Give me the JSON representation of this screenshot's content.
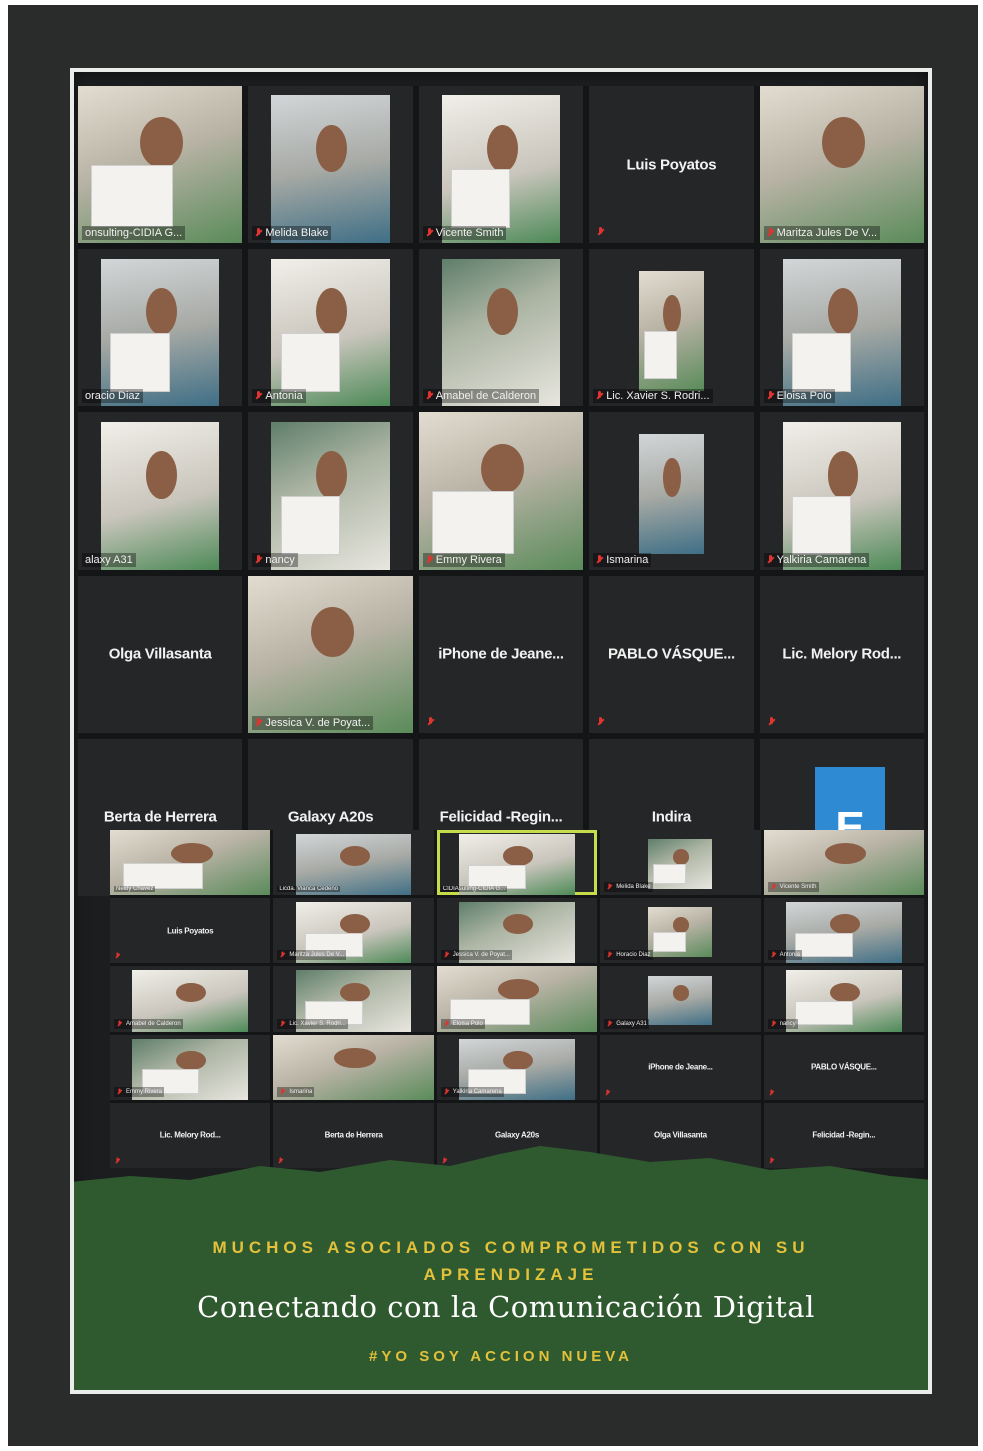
{
  "meeting_main": {
    "tiles": [
      {
        "label": "onsulting-CIDIA G...",
        "kind": "video",
        "active": true,
        "mic_muted": false
      },
      {
        "label": "Melida Blake",
        "kind": "video",
        "mic_muted": true
      },
      {
        "label": "Vicente Smith",
        "kind": "video",
        "mic_muted": true
      },
      {
        "label": "Luis Poyatos",
        "kind": "name",
        "mic_muted": true
      },
      {
        "label": "Maritza Jules De V...",
        "kind": "video",
        "mic_muted": true
      },
      {
        "label": "oracio Diaz",
        "kind": "video",
        "mic_muted": false
      },
      {
        "label": "Antonia",
        "kind": "video",
        "mic_muted": true
      },
      {
        "label": "Amabel de Calderon",
        "kind": "video",
        "mic_muted": true
      },
      {
        "label": "Lic. Xavier S. Rodri...",
        "kind": "video",
        "mic_muted": true
      },
      {
        "label": "Eloisa Polo",
        "kind": "video",
        "mic_muted": true
      },
      {
        "label": "alaxy A31",
        "kind": "video",
        "mic_muted": false
      },
      {
        "label": "nancy",
        "kind": "video",
        "mic_muted": true
      },
      {
        "label": "Emmy Rivera",
        "kind": "video",
        "mic_muted": true
      },
      {
        "label": "Ismarina",
        "kind": "video",
        "mic_muted": true
      },
      {
        "label": "Yalkiria Camarena",
        "kind": "video",
        "mic_muted": true
      },
      {
        "label": "Olga Villasanta",
        "kind": "name",
        "mic_muted": false
      },
      {
        "label": "Jessica V. de Poyat...",
        "kind": "video",
        "mic_muted": true
      },
      {
        "label": "iPhone de Jeane...",
        "kind": "name",
        "mic_muted": true
      },
      {
        "label": "PABLO VÁSQUE...",
        "kind": "name",
        "mic_muted": true
      },
      {
        "label": "Lic. Melory Rod...",
        "kind": "name",
        "mic_muted": true
      },
      {
        "label": "Berta de Herrera",
        "kind": "name",
        "mic_muted": false
      },
      {
        "label": "Galaxy A20s",
        "kind": "name",
        "mic_muted": false
      },
      {
        "label": "Felicidad -Regin...",
        "kind": "name",
        "mic_muted": false
      },
      {
        "label": "Indira",
        "kind": "name",
        "mic_muted": false
      },
      {
        "label": "E",
        "kind": "avatar",
        "mic_muted": false
      }
    ]
  },
  "meeting_secondary": {
    "tiles": [
      {
        "label": "Neidy Chávez",
        "kind": "video",
        "mic_muted": false
      },
      {
        "label": "Licda. Vianca Cedeño",
        "kind": "video",
        "mic_muted": false
      },
      {
        "label": "CIDIAsulting-CIDIA G...",
        "kind": "video",
        "active": true,
        "mic_muted": false
      },
      {
        "label": "Melida Blake",
        "kind": "video",
        "mic_muted": true
      },
      {
        "label": "Vicente Smith",
        "kind": "video",
        "mic_muted": true
      },
      {
        "label": "Luis Poyatos",
        "kind": "name",
        "mic_muted": true
      },
      {
        "label": "Maritza Jules De V...",
        "kind": "video",
        "mic_muted": true
      },
      {
        "label": "Jessica V. de Poyat...",
        "kind": "video",
        "mic_muted": true
      },
      {
        "label": "Horacio Diaz",
        "kind": "video",
        "mic_muted": true
      },
      {
        "label": "Antonia",
        "kind": "video",
        "mic_muted": true
      },
      {
        "label": "Amabel de Calderon",
        "kind": "video",
        "mic_muted": true
      },
      {
        "label": "Lic. Xavier S. Rodri...",
        "kind": "video",
        "mic_muted": true
      },
      {
        "label": "Eloisa Polo",
        "kind": "video",
        "mic_muted": true
      },
      {
        "label": "Galaxy A31",
        "kind": "video",
        "mic_muted": true
      },
      {
        "label": "nancy",
        "kind": "video",
        "mic_muted": true
      },
      {
        "label": "Emmy Rivera",
        "kind": "video",
        "mic_muted": true
      },
      {
        "label": "Ismarina",
        "kind": "video",
        "mic_muted": true
      },
      {
        "label": "Yalkiria Camarena",
        "kind": "video",
        "mic_muted": true
      },
      {
        "label": "iPhone de Jeane...",
        "kind": "name",
        "mic_muted": true
      },
      {
        "label": "PABLO VÁSQUE...",
        "kind": "name",
        "mic_muted": true
      },
      {
        "label": "Lic. Melory Rod...",
        "kind": "name",
        "mic_muted": true
      },
      {
        "label": "Berta de Herrera",
        "kind": "name",
        "mic_muted": true
      },
      {
        "label": "Galaxy A20s",
        "kind": "name",
        "mic_muted": true
      },
      {
        "label": "Olga Villasanta",
        "kind": "name",
        "mic_muted": true
      },
      {
        "label": "Felicidad -Regin...",
        "kind": "name",
        "mic_muted": true
      }
    ]
  },
  "footer": {
    "headline": "MUCHOS ASOCIADOS COMPROMETIDOS CON SU APRENDIZAJE",
    "subtitle": "Conectando con la Comunicación Digital",
    "hashtag": "#YO SOY ACCION NUEVA"
  },
  "colors": {
    "frame": "#2a2c2b",
    "meeting_bg": "#1c1d1f",
    "tile_bg": "#252628",
    "active_speaker": "#c7dc4a",
    "mic_muted": "#e0342f",
    "avatar": "#2e8ad3",
    "green_panel": "#2f5a2f",
    "headline_gold": "#e3c13a"
  },
  "icons": [
    "mic-muted-icon",
    "avatar-e-icon",
    "mountain-silhouette"
  ]
}
